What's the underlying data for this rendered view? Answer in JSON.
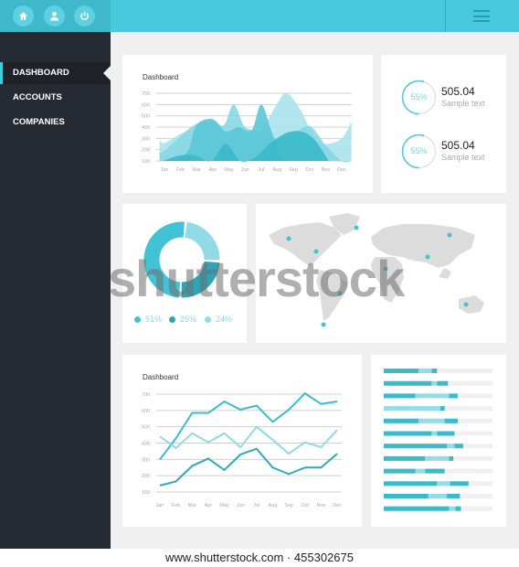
{
  "header": {
    "icons": [
      "home-icon",
      "user-icon",
      "power-icon"
    ],
    "menu_icon": "hamburger-menu-icon"
  },
  "sidebar": {
    "items": [
      {
        "label": "DASHBOARD",
        "active": true
      },
      {
        "label": "ACCOUNTS"
      },
      {
        "label": "COMPANIES"
      }
    ]
  },
  "colors": {
    "accent": "#47c8dc",
    "sidebar": "#262a33",
    "background": "#f0f0f0",
    "dark_teal": "#36b3c5",
    "light_teal": "#94dce7"
  },
  "stats": [
    {
      "percent": "55%",
      "percent_value": 55,
      "value": "505.04",
      "label": "Sample text"
    },
    {
      "percent": "55%",
      "percent_value": 55,
      "value": "505.04",
      "label": "Sample text"
    }
  ],
  "donut": {
    "slices": [
      {
        "label": "51%",
        "value": 51,
        "color": "#44c2d5"
      },
      {
        "label": "25%",
        "value": 25,
        "color": "#2ea4b5"
      },
      {
        "label": "24%",
        "value": 24,
        "color": "#91dbe7"
      }
    ]
  },
  "watermark": "shutterstock",
  "footer": "www.shutterstock.com · 455302675",
  "chart_data": [
    {
      "type": "area",
      "title": "Dashboard",
      "categories": [
        "Jan",
        "Feb",
        "Mar",
        "Apr",
        "May",
        "Jun",
        "Jul",
        "Aug",
        "Sep",
        "Oct",
        "Nov",
        "Dec"
      ],
      "yticks": [
        "700",
        "600",
        "500",
        "400",
        "300",
        "200",
        "100"
      ],
      "ylim": [
        100,
        700
      ],
      "series": [
        {
          "color": "#a9e3ec",
          "points": [
            [
              -0.3,
              290
            ],
            [
              0,
              260
            ],
            [
              1,
              340
            ],
            [
              2,
              395
            ],
            [
              3,
              380
            ],
            [
              4,
              370
            ],
            [
              5,
              390
            ],
            [
              6,
              380
            ],
            [
              7,
              610
            ],
            [
              7.6,
              700
            ],
            [
              8.5,
              540
            ],
            [
              9.3,
              300
            ],
            [
              10,
              250
            ],
            [
              11,
              300
            ],
            [
              11.6,
              450
            ]
          ]
        },
        {
          "color": "#87d7e4",
          "points": [
            [
              -0.3,
              180
            ],
            [
              0,
              190
            ],
            [
              1,
              320
            ],
            [
              2,
              430
            ],
            [
              3,
              450
            ],
            [
              3.7,
              420
            ],
            [
              4.3,
              600
            ],
            [
              5,
              400
            ],
            [
              6,
              360
            ],
            [
              7,
              300
            ],
            [
              8,
              340
            ],
            [
              9,
              410
            ],
            [
              10,
              240
            ],
            [
              11,
              100
            ],
            [
              11.6,
              100
            ]
          ]
        },
        {
          "color": "#5ac7d7",
          "points": [
            [
              0.8,
              100
            ],
            [
              1.5,
              200
            ],
            [
              2,
              420
            ],
            [
              3,
              470
            ],
            [
              3.8,
              360
            ],
            [
              4.6,
              400
            ],
            [
              5.4,
              370
            ],
            [
              6,
              600
            ],
            [
              6.6,
              380
            ],
            [
              7.2,
              150
            ],
            [
              7.8,
              100
            ]
          ]
        },
        {
          "color": "#39b9cb",
          "points": [
            [
              -0.1,
              100
            ],
            [
              1,
              150
            ],
            [
              2,
              145
            ],
            [
              2.9,
              100
            ],
            [
              3.8,
              250
            ],
            [
              4.7,
              100
            ],
            [
              5.6,
              130
            ],
            [
              6.6,
              260
            ],
            [
              7.6,
              350
            ],
            [
              8.5,
              360
            ],
            [
              9.3,
              290
            ],
            [
              10.2,
              100
            ]
          ]
        }
      ]
    },
    {
      "type": "line",
      "title": "Dashboard",
      "categories": [
        "Jan",
        "Feb",
        "Mar",
        "Apr",
        "May",
        "Jun",
        "Jul",
        "Aug",
        "Sep",
        "Oct",
        "Nov",
        "Dec"
      ],
      "yticks": [
        "700",
        "600",
        "500",
        "400",
        "300",
        "200",
        "100"
      ],
      "ylim": [
        100,
        700
      ],
      "series": [
        {
          "color": "#3dbbcd",
          "values": [
            300,
            430,
            585,
            585,
            655,
            605,
            630,
            530,
            605,
            705,
            640,
            655
          ]
        },
        {
          "color": "#90d9e5",
          "values": [
            440,
            370,
            460,
            405,
            460,
            375,
            500,
            420,
            335,
            405,
            375,
            480
          ]
        },
        {
          "color": "#2fa9ba",
          "values": [
            140,
            165,
            260,
            305,
            235,
            330,
            365,
            250,
            210,
            250,
            250,
            335
          ]
        }
      ]
    },
    {
      "type": "bar",
      "orientation": "horizontal",
      "stacked": true,
      "segment_colors": [
        "#3bbacb",
        "#94dce7",
        "#3bbacb"
      ],
      "rows": [
        [
          32,
          12,
          5
        ],
        [
          44,
          5,
          10
        ],
        [
          29,
          31,
          8
        ],
        [
          0,
          52,
          4
        ],
        [
          32,
          24,
          12
        ],
        [
          44,
          5,
          16
        ],
        [
          58,
          7,
          8
        ],
        [
          38,
          22,
          4
        ],
        [
          29,
          9,
          18
        ],
        [
          49,
          12,
          17
        ],
        [
          41,
          17,
          12
        ],
        [
          60,
          6,
          5
        ]
      ]
    }
  ]
}
